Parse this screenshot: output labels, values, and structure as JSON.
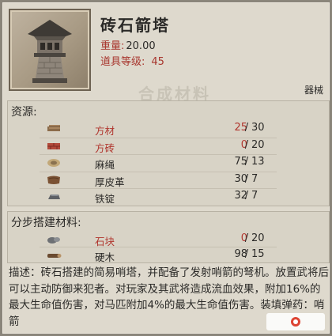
{
  "item": {
    "name": "砖石箭塔",
    "weight_label": "重量:",
    "weight_value": "20.00",
    "level_label": "道具等级:",
    "level_value": "45",
    "category": "器械",
    "watermark": "合成材料"
  },
  "resources": {
    "title": "资源:",
    "rows": [
      {
        "icon": "lumber-icon",
        "name": "方材",
        "name_color": "red",
        "have": "25",
        "need": "30",
        "have_color": "red"
      },
      {
        "icon": "brick-icon",
        "name": "方砖",
        "name_color": "red",
        "have": "0",
        "need": "20",
        "have_color": "red"
      },
      {
        "icon": "rope-icon",
        "name": "麻绳",
        "name_color": "dark",
        "have": "75",
        "need": "13",
        "have_color": "dark"
      },
      {
        "icon": "thick-leather-icon",
        "name": "厚皮革",
        "name_color": "dark",
        "have": "30",
        "need": "7",
        "have_color": "dark"
      },
      {
        "icon": "iron-ingot-icon",
        "name": "铁锭",
        "name_color": "dark",
        "have": "32",
        "need": "7",
        "have_color": "dark"
      }
    ]
  },
  "build_materials": {
    "title": "分步搭建材料:",
    "rows": [
      {
        "icon": "stone-icon",
        "name": "石块",
        "name_color": "red",
        "have": "0",
        "need": "20",
        "have_color": "red"
      },
      {
        "icon": "hardwood-icon",
        "name": "硬木",
        "name_color": "dark",
        "have": "98",
        "need": "15",
        "have_color": "dark"
      }
    ]
  },
  "description": {
    "text": "描述：砖石搭建的简易哨塔，并配备了发射哨箭的弩机。放置武将后可以主动防御来犯者。对玩家及其武将造成流血效果，附加16%的最大生命值伤害，对马匹附加4%的最大生命值伤害。装填弹药：哨箭"
  },
  "colors": {
    "red": "#b0362e",
    "dark": "#2b2a28",
    "panel": "#ded9cd"
  }
}
